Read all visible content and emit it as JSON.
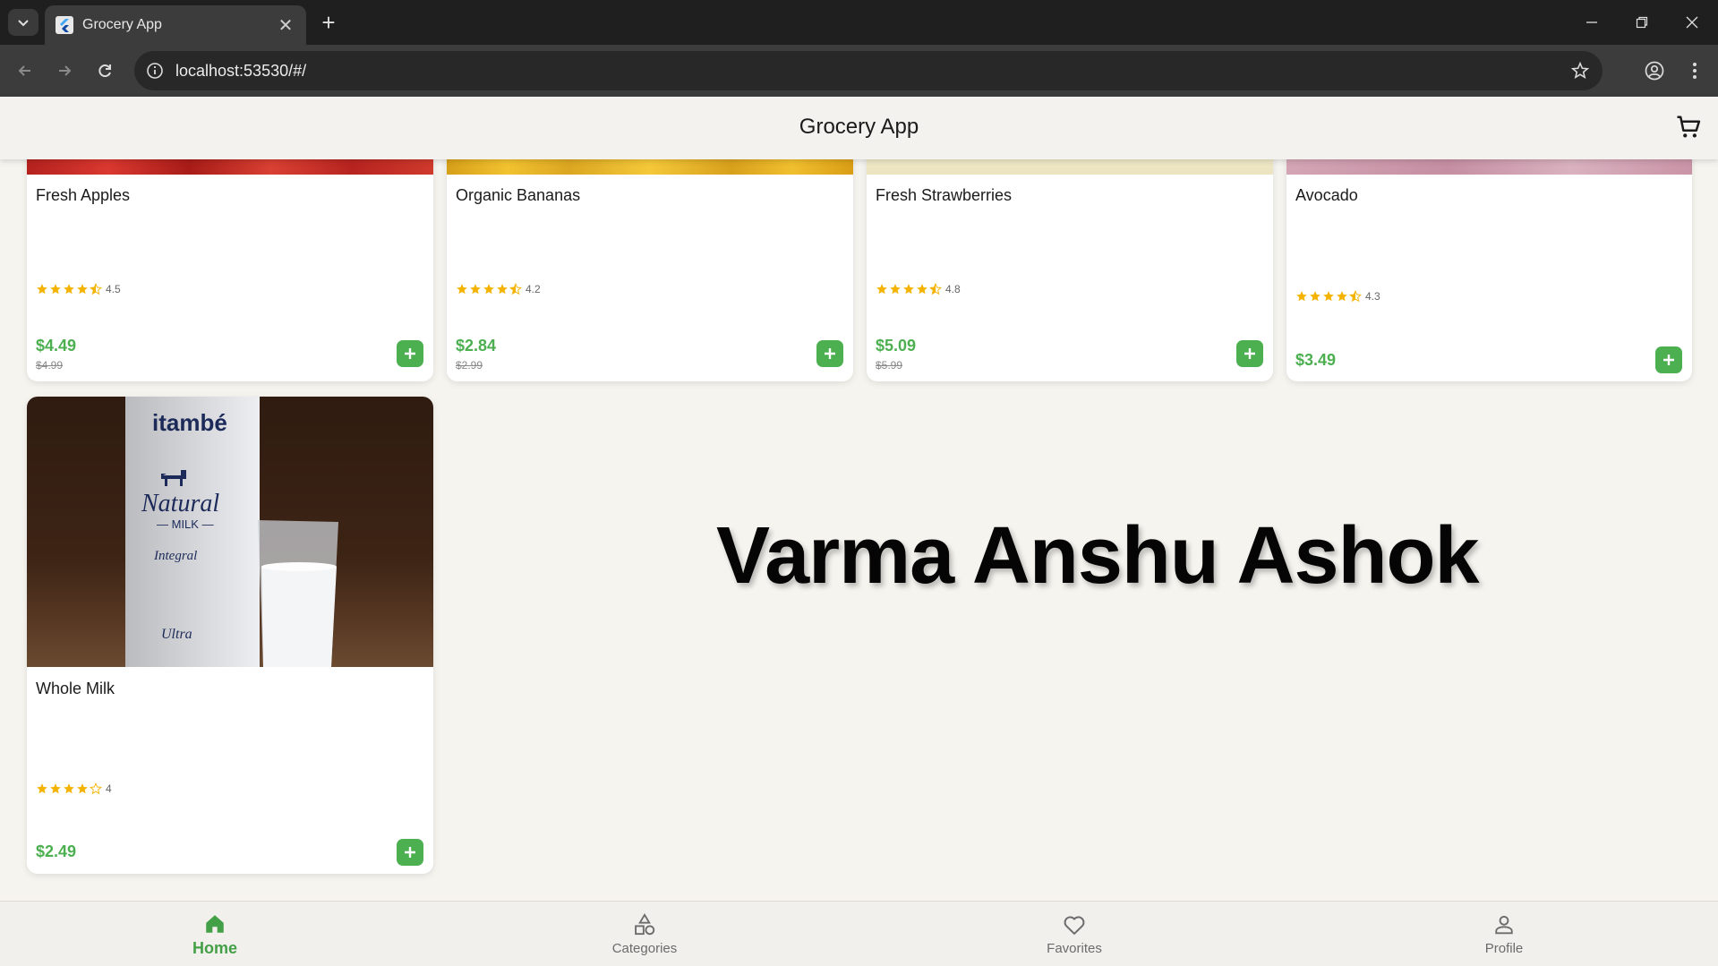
{
  "browser": {
    "tab_title": "Grocery App",
    "url": "localhost:53530/#/"
  },
  "app": {
    "title": "Grocery App"
  },
  "products": [
    {
      "name": "Fresh Apples",
      "rating": "4.5",
      "price": "$4.49",
      "old_price": "$4.99"
    },
    {
      "name": "Organic Bananas",
      "rating": "4.2",
      "price": "$2.84",
      "old_price": "$2.99"
    },
    {
      "name": "Fresh Strawberries",
      "rating": "4.8",
      "price": "$5.09",
      "old_price": "$5.99"
    },
    {
      "name": "Avocado",
      "rating": "4.3",
      "price": "$3.49"
    },
    {
      "name": "Whole Milk",
      "rating": "4",
      "price": "$2.49",
      "image_text": {
        "brand": "itambé",
        "line1": "Natural",
        "line2": "— MILK —",
        "line3": "Integral",
        "line4": "Ultra"
      }
    }
  ],
  "overlay_text": "Varma Anshu Ashok",
  "bottom_nav": [
    {
      "label": "Home",
      "icon": "home-icon",
      "active": true
    },
    {
      "label": "Categories",
      "icon": "categories-icon",
      "active": false
    },
    {
      "label": "Favorites",
      "icon": "heart-icon",
      "active": false
    },
    {
      "label": "Profile",
      "icon": "person-icon",
      "active": false
    }
  ],
  "colors": {
    "accent_green": "#4caf50",
    "star": "#f5b301",
    "browser_dark": "#1f1f1f"
  }
}
